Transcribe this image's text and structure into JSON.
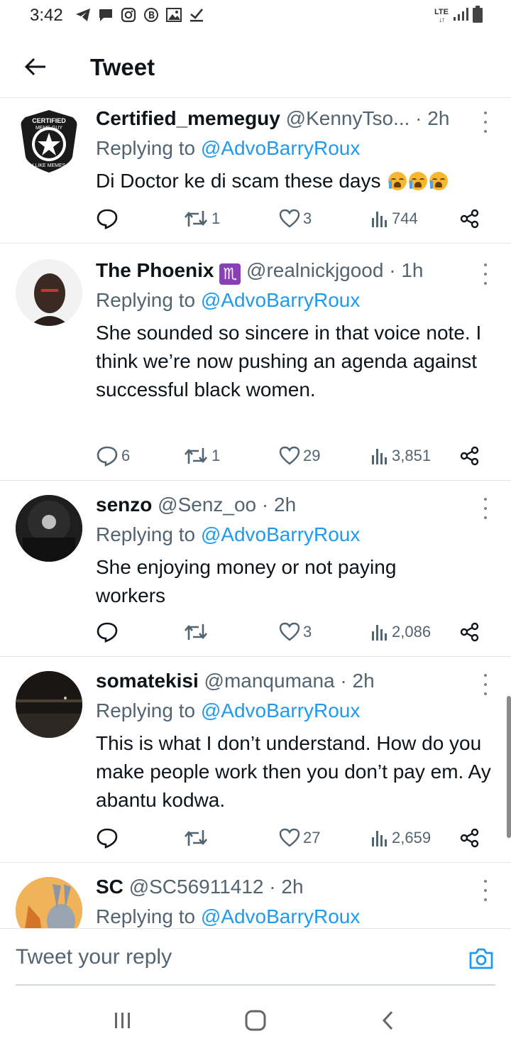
{
  "status_bar": {
    "time": "3:42",
    "network": "LTE",
    "icons": [
      "telegram-icon",
      "message-icon",
      "instagram-icon",
      "b-badge-icon",
      "gallery-icon",
      "check-download-icon",
      "signal-icon",
      "battery-icon"
    ]
  },
  "header": {
    "title": "Tweet"
  },
  "tweets": [
    {
      "name": "Certified_memeguy",
      "handle": "@KennyTso...",
      "time": "· 2h",
      "replying_prefix": "Replying to ",
      "replying_to": "@AdvoBarryRoux",
      "text": "Di Doctor ke di scam these days",
      "emoji_count": 3,
      "replies": "",
      "retweets": "1",
      "likes": "3",
      "views": "744"
    },
    {
      "name": "The Phoenix",
      "badge": "♏",
      "handle": "@realnickjgood",
      "time": "· 1h",
      "replying_prefix": "Replying to ",
      "replying_to": "@AdvoBarryRoux",
      "text": "She sounded so sincere in that voice note. I think we’re now pushing an agenda against successful black women.",
      "replies": "6",
      "retweets": "1",
      "likes": "29",
      "views": "3,851"
    },
    {
      "name": "senzo",
      "handle": "@Senz_oo",
      "time": "· 2h",
      "replying_prefix": "Replying to ",
      "replying_to": "@AdvoBarryRoux",
      "text": "She enjoying money or not paying workers",
      "replies": "",
      "retweets": "",
      "likes": "3",
      "views": "2,086"
    },
    {
      "name": "somatekisi",
      "handle": "@manqumana",
      "time": "· 2h",
      "replying_prefix": "Replying to ",
      "replying_to": "@AdvoBarryRoux",
      "text": "This is what I don’t understand. How do you make people work then you don’t pay em. Ay abantu kodwa.",
      "replies": "",
      "retweets": "",
      "likes": "27",
      "views": "2,659"
    },
    {
      "name": "SC",
      "handle": "@SC56911412",
      "time": "· 2h",
      "replying_prefix": "Replying to ",
      "replying_to": "@AdvoBarryRoux"
    }
  ],
  "composer": {
    "placeholder": "Tweet your reply"
  },
  "avatar_logo": {
    "top": "CERTIFIED",
    "mid": "MEME GUY",
    "bottom": "I LIKE MEMES"
  },
  "colors": {
    "accent": "#1d9bf0",
    "secondary_text": "#536471",
    "primary_text": "#0f1419",
    "divider": "#e6e6e6"
  }
}
